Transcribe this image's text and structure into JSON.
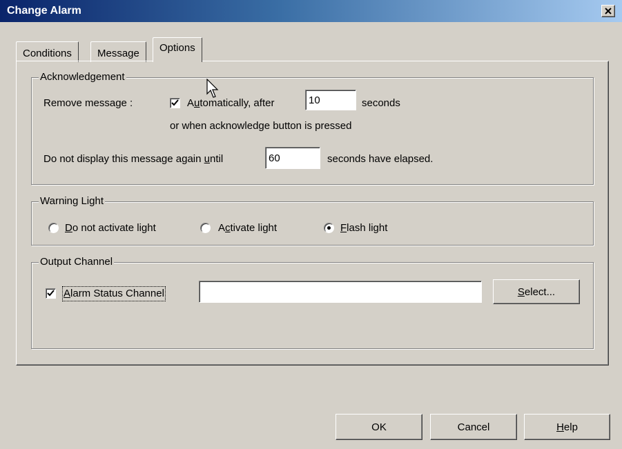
{
  "window": {
    "title": "Change Alarm",
    "close_glyph": "×"
  },
  "tabs": [
    {
      "label": "Conditions",
      "active": false
    },
    {
      "label": "Message",
      "active": false
    },
    {
      "label": "Options",
      "active": true
    }
  ],
  "acknowledgement": {
    "legend": "Acknowledgement",
    "remove_label": "Remove message :",
    "auto_checked": true,
    "auto_label_pre": "A",
    "auto_label_u": "u",
    "auto_label_post": "tomatically, after",
    "seconds_value": "10",
    "seconds_label": "seconds",
    "or_label": "or when acknowledge button is pressed",
    "repeat_label_pre": "Do not display this message again ",
    "repeat_label_u": "u",
    "repeat_label_post": "ntil",
    "repeat_value": "60",
    "elapsed_label": "seconds have elapsed."
  },
  "warning_light": {
    "legend": "Warning Light",
    "options": [
      {
        "u": "D",
        "rest": "o not activate light",
        "selected": false
      },
      {
        "pre": "A",
        "u": "c",
        "rest": "tivate light",
        "selected": false
      },
      {
        "u": "F",
        "rest": "lash light",
        "selected": true
      }
    ]
  },
  "output_channel": {
    "legend": "Output Channel",
    "checked": true,
    "check_u": "A",
    "check_rest": "larm Status Channel",
    "channel_value": "",
    "select_u": "S",
    "select_rest": "elect..."
  },
  "buttons": {
    "ok": "OK",
    "cancel": "Cancel",
    "help_u": "H",
    "help_rest": "elp"
  },
  "icons": {
    "check": "check-mark-icon",
    "close": "close-icon",
    "cursor": "mouse-pointer-icon"
  }
}
